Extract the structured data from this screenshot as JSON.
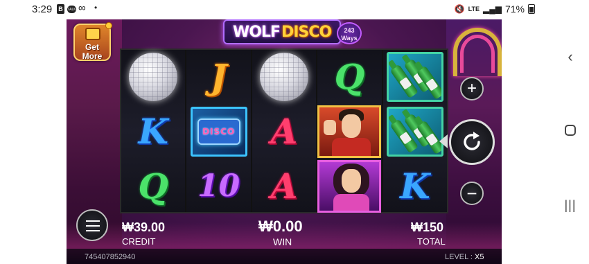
{
  "status_bar": {
    "time": "3:29",
    "icons": [
      "b-app-icon",
      "talk-icon",
      "infinity-icon",
      "dot-icon"
    ],
    "b_glyph": "B",
    "talk_glyph": "TALK",
    "infinity_glyph": "∞",
    "dot_glyph": "•",
    "mute_glyph": "🔇",
    "network": "LTE",
    "battery": "71%"
  },
  "game": {
    "title_part1": "WOLF",
    "title_part2": "DISCO",
    "ways": "243 Ways",
    "get_more_label": "Get\nMore",
    "reels": [
      [
        "disco-ball",
        "K",
        "Q"
      ],
      [
        "J",
        "radio-wild",
        "10"
      ],
      [
        "disco-ball",
        "A",
        "A"
      ],
      [
        "Q",
        "man",
        "woman"
      ],
      [
        "bottles",
        "bottles",
        "K"
      ]
    ],
    "radio_text": "DISCO",
    "plus_glyph": "+",
    "minus_glyph": "−",
    "credit": {
      "amount": "₩39.00",
      "label": "CREDIT"
    },
    "win": {
      "amount": "₩0.00",
      "label": "WIN"
    },
    "total": {
      "amount": "₩150",
      "label": "TOTAL"
    },
    "round_id": "745407852940",
    "level_label": "LEVEL :",
    "level_value": "X5"
  },
  "nav": {
    "back_glyph": "‹",
    "recent_glyph": "|||"
  },
  "colors": {
    "gold": "#ffd23a",
    "pink": "#e84a9a",
    "purple": "#c35cff"
  }
}
